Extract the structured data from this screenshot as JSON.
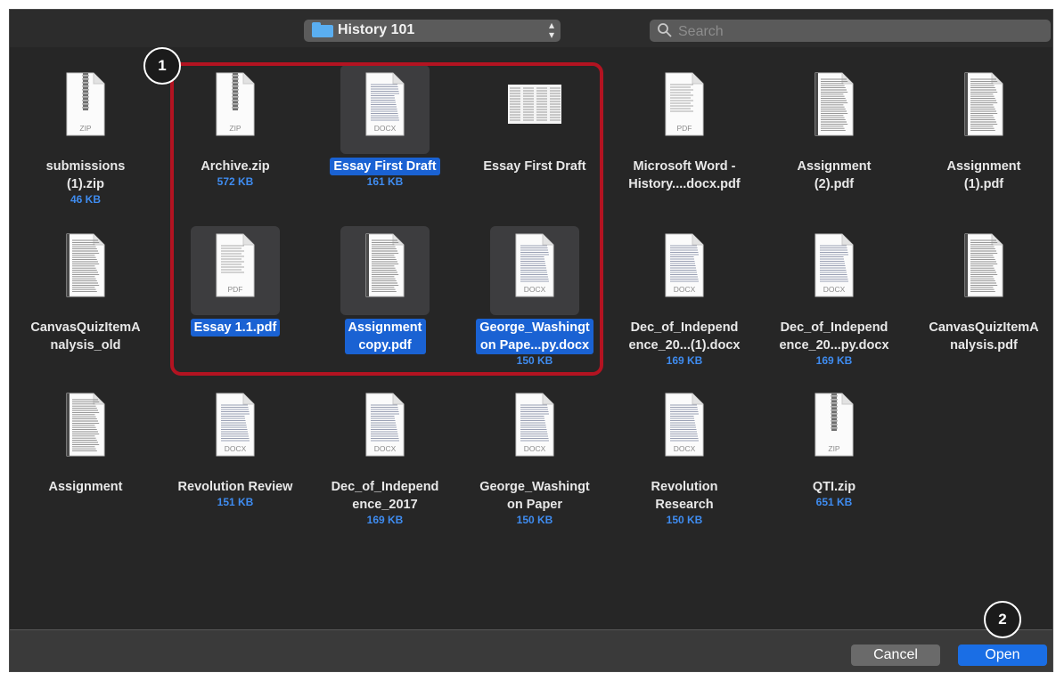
{
  "location": {
    "folder_name": "History 101"
  },
  "search": {
    "placeholder": "Search"
  },
  "files": [
    {
      "name": "submissions (1).zip",
      "kind": "zip",
      "size": "46 KB",
      "selected": false
    },
    {
      "name": "Archive.zip",
      "kind": "zip",
      "size": "572 KB",
      "selected": false
    },
    {
      "name": "Essay First Draft",
      "kind": "docx",
      "size": "161 KB",
      "selected": true
    },
    {
      "name": "Essay First Draft",
      "kind": "pages",
      "size": "",
      "selected": false
    },
    {
      "name": "Microsoft Word - History....docx.pdf",
      "kind": "pdf",
      "size": "",
      "selected": false
    },
    {
      "name": "Assignment (2).pdf",
      "kind": "doc",
      "size": "",
      "selected": false
    },
    {
      "name": "Assignment (1).pdf",
      "kind": "doc",
      "size": "",
      "selected": false
    },
    {
      "name": "CanvasQuizItemAnalysis_old",
      "kind": "doc",
      "size": "",
      "selected": false
    },
    {
      "name": "Essay 1.1.pdf",
      "kind": "pdf",
      "size": "",
      "selected": true
    },
    {
      "name": "Assignment copy.pdf",
      "kind": "doc",
      "size": "",
      "selected": true
    },
    {
      "name": "George_Washington Pape...py.docx",
      "kind": "docx",
      "size": "150 KB",
      "selected": true
    },
    {
      "name": "Dec_of_Independence_20...(1).docx",
      "kind": "docx",
      "size": "169 KB",
      "selected": false
    },
    {
      "name": "Dec_of_Independence_20...py.docx",
      "kind": "docx",
      "size": "169 KB",
      "selected": false
    },
    {
      "name": "CanvasQuizItemAnalysis.pdf",
      "kind": "doc",
      "size": "",
      "selected": false
    },
    {
      "name": "Assignment",
      "kind": "doc",
      "size": "",
      "selected": false
    },
    {
      "name": "Revolution Review",
      "kind": "docx",
      "size": "151 KB",
      "selected": false
    },
    {
      "name": "Dec_of_Independence_2017",
      "kind": "docx",
      "size": "169 KB",
      "selected": false
    },
    {
      "name": "George_Washington Paper",
      "kind": "docx",
      "size": "150 KB",
      "selected": false
    },
    {
      "name": "Revolution Research",
      "kind": "docx",
      "size": "150 KB",
      "selected": false
    },
    {
      "name": "QTI.zip",
      "kind": "zip",
      "size": "651 KB",
      "selected": false
    }
  ],
  "name_lines": [
    [
      "submissions",
      "(1).zip"
    ],
    [
      "Archive.zip"
    ],
    [
      "Essay First Draft"
    ],
    [
      "Essay First Draft"
    ],
    [
      "Microsoft Word -",
      "History....docx.pdf"
    ],
    [
      "Assignment",
      "(2).pdf"
    ],
    [
      "Assignment",
      "(1).pdf"
    ],
    [
      "CanvasQuizItemA",
      "nalysis_old"
    ],
    [
      "Essay 1.1.pdf"
    ],
    [
      "Assignment",
      "copy.pdf"
    ],
    [
      "George_Washingt",
      "on Pape...py.docx"
    ],
    [
      "Dec_of_Independ",
      "ence_20...(1).docx"
    ],
    [
      "Dec_of_Independ",
      "ence_20...py.docx"
    ],
    [
      "CanvasQuizItemA",
      "nalysis.pdf"
    ],
    [
      "Assignment"
    ],
    [
      "Revolution Review"
    ],
    [
      "Dec_of_Independ",
      "ence_2017"
    ],
    [
      "George_Washingt",
      "on Paper"
    ],
    [
      "Revolution",
      "Research"
    ],
    [
      "QTI.zip"
    ]
  ],
  "icon_labels": {
    "zip": "ZIP",
    "pdf": "PDF",
    "docx": "DOCX"
  },
  "annotations": {
    "step1": "1",
    "step2": "2"
  },
  "buttons": {
    "cancel": "Cancel",
    "open": "Open"
  },
  "colors": {
    "selection": "#1a62d3",
    "highlight_box": "#b31321",
    "size_text": "#3f8cf0",
    "open_button": "#1a6ee5"
  }
}
